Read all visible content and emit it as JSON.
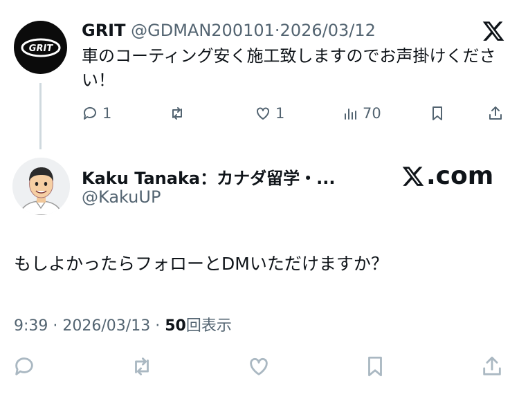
{
  "parent_tweet": {
    "name": "GRIT",
    "handle": "@GDMAN200101",
    "separator": "·",
    "date": "2026/03/12",
    "avatar_text": "GRIT",
    "text": "車のコーティング安く施工致しますのでお声掛けください！",
    "reply_count": "1",
    "like_count": "1",
    "view_count": "70"
  },
  "reply_tweet": {
    "name": "Kaku Tanaka：カナダ留学・...",
    "handle": "@KakuUP",
    "text": "もしよかったらフォローとDMいただけますか？",
    "time": "9:39",
    "separator": "·",
    "date": "2026/03/13",
    "views": "50",
    "views_label": "回表示"
  },
  "brand": {
    "xcom_label": ".com"
  },
  "icons": [
    "x-logo-icon",
    "reply-icon",
    "retweet-icon",
    "like-icon",
    "views-icon",
    "bookmark-icon",
    "share-icon"
  ],
  "colors": {
    "text": "#0f1419",
    "muted": "#536471",
    "line": "#cfd9de",
    "faint": "#aab8c2"
  }
}
